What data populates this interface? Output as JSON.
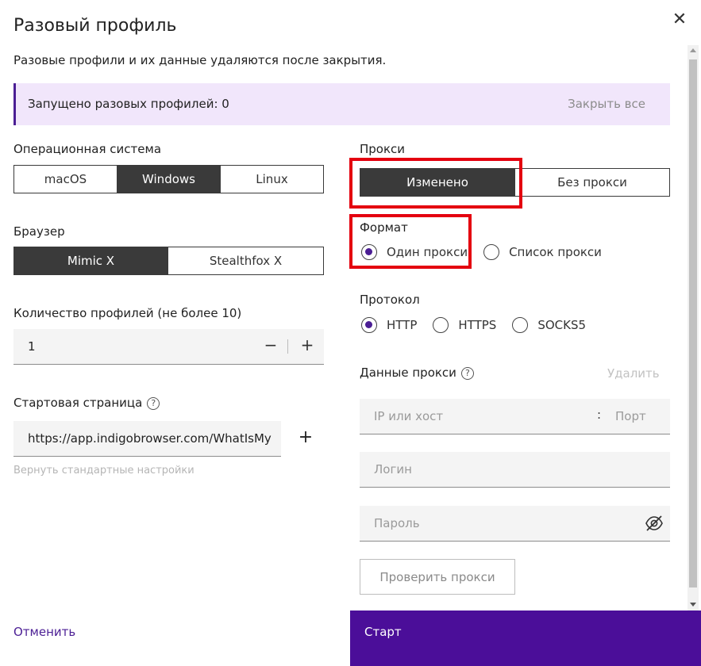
{
  "dialog": {
    "title": "Разовый профиль",
    "subtitle": "Разовые профили и их данные удаляются после закрытия."
  },
  "banner": {
    "text": "Запущено разовых профилей: 0",
    "close_all": "Закрыть все"
  },
  "os": {
    "label": "Операционная система",
    "options": [
      "macOS",
      "Windows",
      "Linux"
    ],
    "selected": "Windows"
  },
  "browser": {
    "label": "Браузер",
    "options": [
      "Mimic X",
      "Stealthfox X"
    ],
    "selected": "Mimic X"
  },
  "count": {
    "label": "Количество профилей (не более 10)",
    "value": "1",
    "minus": "−",
    "plus": "+"
  },
  "start_page": {
    "label": "Стартовая страница",
    "help": "?",
    "value": "https://app.indigobrowser.com/WhatIsMy",
    "add": "+",
    "reset": "Вернуть стандартные настройки"
  },
  "proxy": {
    "label": "Прокси",
    "options": [
      "Изменено",
      "Без прокси"
    ],
    "selected": "Изменено"
  },
  "format": {
    "label": "Формат",
    "options": [
      "Один прокси",
      "Список прокси"
    ],
    "selected": "Один прокси"
  },
  "protocol": {
    "label": "Протокол",
    "options": [
      "HTTP",
      "HTTPS",
      "SOCKS5"
    ],
    "selected": "HTTP"
  },
  "proxy_data": {
    "label": "Данные прокси",
    "help": "?",
    "delete": "Удалить",
    "host_placeholder": "IP или хост",
    "separator": ":",
    "port_placeholder": "Порт",
    "login_placeholder": "Логин",
    "password_placeholder": "Пароль",
    "check_button": "Проверить прокси"
  },
  "footer": {
    "cancel": "Отменить",
    "start": "Старт"
  },
  "colors": {
    "accent": "#4b0e99",
    "banner_bg": "#f1e6fb",
    "highlight": "#e4000f",
    "segment_active": "#3a3a3a"
  },
  "icons": {
    "close": "close-icon",
    "eye_off": "eye-off-icon",
    "help": "help-circle-icon"
  }
}
